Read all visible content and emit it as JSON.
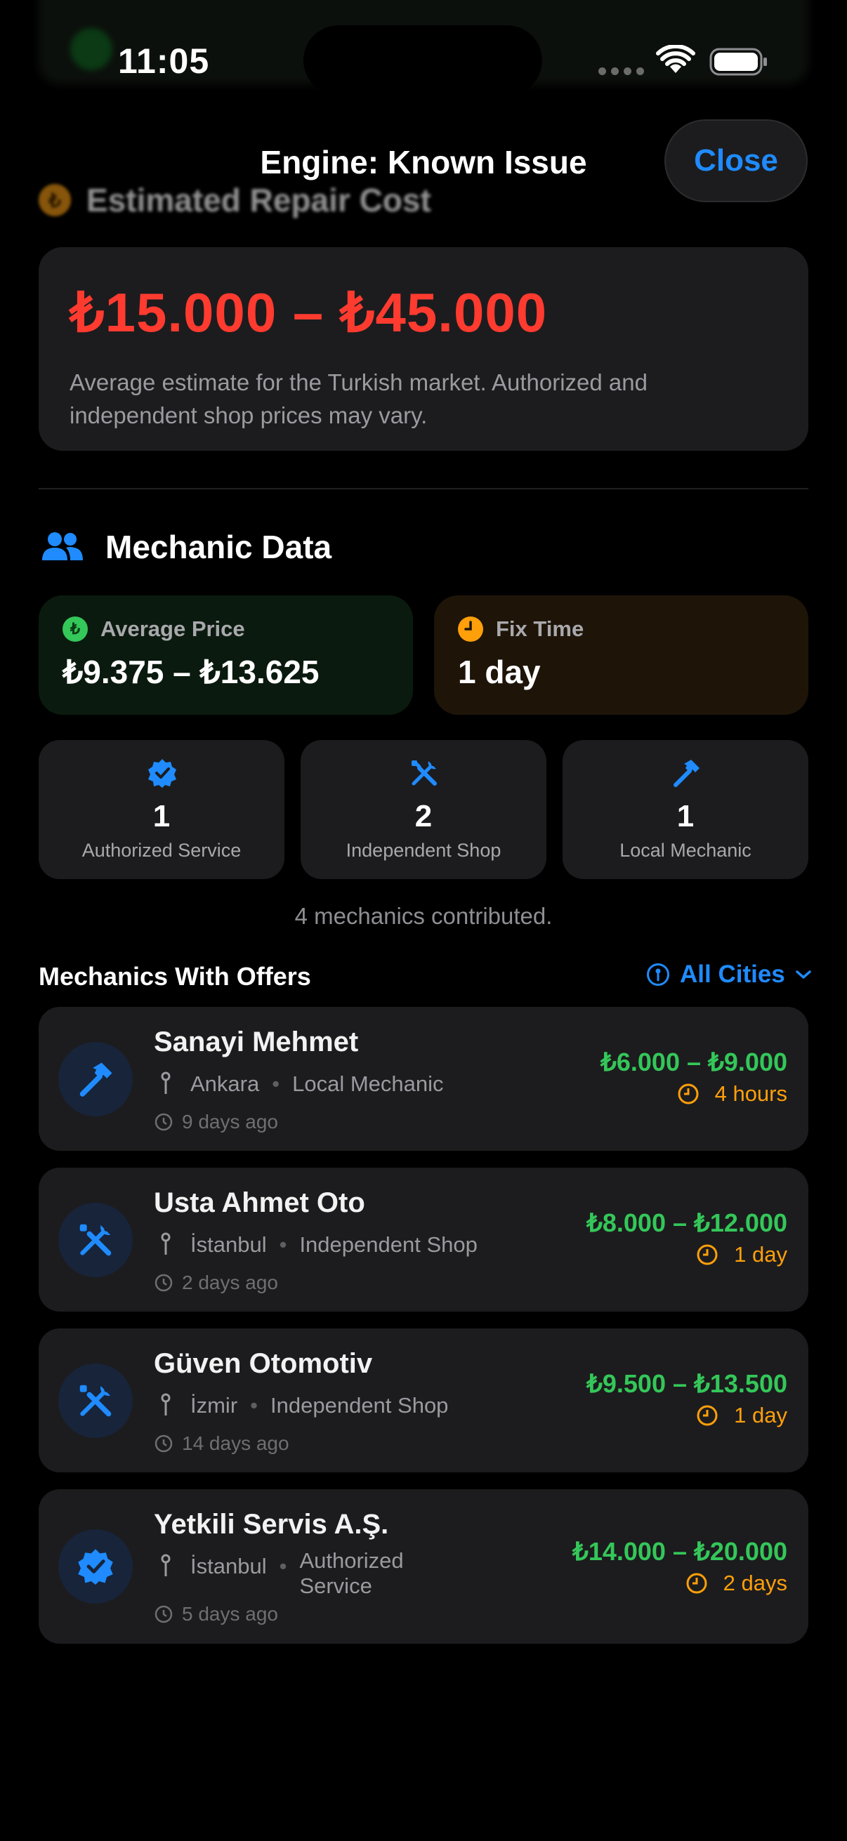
{
  "status_bar": {
    "time": "11:05"
  },
  "nav": {
    "title": "Engine: Known Issue",
    "close_label": "Close"
  },
  "estimate": {
    "section_title": "Estimated Repair Cost",
    "coin_symbol": "₺",
    "range": "₺15.000 – ₺45.000",
    "description": "Average estimate for the Turkish market. Authorized and independent shop prices may vary."
  },
  "mechanic_data": {
    "title": "Mechanic Data",
    "avg_price": {
      "label": "Average Price",
      "value": "₺9.375 – ₺13.625"
    },
    "fix_time": {
      "label": "Fix Time",
      "value": "1 day"
    },
    "types": [
      {
        "icon": "verified-badge-icon",
        "count": "1",
        "label": "Authorized Service"
      },
      {
        "icon": "tools-icon",
        "count": "2",
        "label": "Independent Shop"
      },
      {
        "icon": "hammer-icon",
        "count": "1",
        "label": "Local Mechanic"
      }
    ],
    "contributed": "4 mechanics contributed."
  },
  "offers": {
    "title": "Mechanics With Offers",
    "city_filter": "All Cities",
    "items": [
      {
        "name": "Sanayi Mehmet",
        "city": "Ankara",
        "type": "Local Mechanic",
        "ago": "9 days ago",
        "price": "₺6.000 – ₺9.000",
        "time": "4 hours",
        "icon": "hammer-icon"
      },
      {
        "name": "Usta Ahmet Oto",
        "city": "İstanbul",
        "type": "Independent Shop",
        "ago": "2 days ago",
        "price": "₺8.000 – ₺12.000",
        "time": "1 day",
        "icon": "tools-icon"
      },
      {
        "name": "Güven Otomotiv",
        "city": "İzmir",
        "type": "Independent Shop",
        "ago": "14 days ago",
        "price": "₺9.500 – ₺13.500",
        "time": "1 day",
        "icon": "tools-icon"
      },
      {
        "name": "Yetkili Servis A.Ş.",
        "city": "İstanbul",
        "type": "Authorized Service",
        "ago": "5 days ago",
        "price": "₺14.000 – ₺20.000",
        "time": "2 days",
        "icon": "verified-badge-icon"
      }
    ]
  },
  "colors": {
    "accent_blue": "#1f8bff",
    "cost_red": "#ff3b30",
    "price_green": "#34c759",
    "time_orange": "#ff9f0a"
  }
}
